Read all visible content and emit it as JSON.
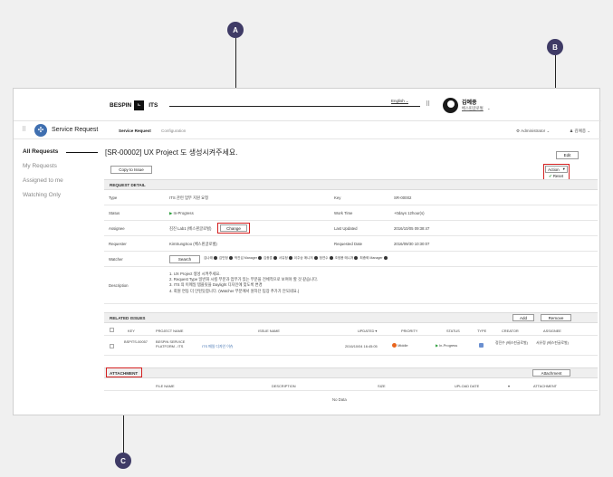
{
  "callouts": {
    "a": "A",
    "b": "B",
    "c": "C"
  },
  "header": {
    "brand": "BESPIN",
    "product": "ITS",
    "language": "English",
    "user_name": "김예종",
    "user_org": "베스핀글로벌"
  },
  "subbar": {
    "app_title": "Service Request",
    "tab_service_request": "Service Request",
    "tab_configuration": "Configuration",
    "admin_label": "Administrator",
    "user_short": "김예종"
  },
  "sidebar": {
    "items": [
      {
        "label": "All Requests"
      },
      {
        "label": "My Requests"
      },
      {
        "label": "Assigned to me"
      },
      {
        "label": "Watching Only"
      }
    ]
  },
  "request": {
    "title": "[SR-00002] UX Project 도 생성시켜주세요.",
    "copy_button": "Copy to Issue",
    "edit_button": "Edit",
    "action_button": "Action",
    "reset_label": "Reset",
    "detail_header": "REQUEST DETAIL",
    "type_label": "Type",
    "type_value": "ITS 관련 업무 지원 요청",
    "key_label": "Key",
    "key_value": "SR-00002",
    "status_label": "Status",
    "status_value": "In-Progress",
    "worktime_label": "Work Time",
    "worktime_value": "+0days 12hour(s)",
    "assignee_label": "Assignee",
    "assignee_value": "김진 Lab1 (베스핀글로벌)",
    "change_button": "Change",
    "lastupdated_label": "Last Updated",
    "lastupdated_value": "2016/10/05 09:38:47",
    "requester_label": "Requester",
    "requester_value": "KimSungSoo (베스핀글로벌)",
    "requested_label": "Requested Date",
    "requested_value": "2016/09/30 10:30:07",
    "watcher_label": "Watcher",
    "search_button": "Search",
    "watchers": [
      "김나래",
      "김민정",
      "박진섭 Manager",
      "김종훈",
      "서유정",
      "이주승 매니저",
      "정연수",
      "조정용 매니저",
      "최종혁 Manager"
    ],
    "description_label": "Description",
    "description_lines": [
      "1. UX Project 생성 시켜주세요.",
      "2. Request Type 일반화 시킬 부분과 업무가 있는 부분을 전체적으로 보여야 할 것 같습니다.",
      "3. ITS 의 이메일 템플릿을 Daylight 디자인에 맞도록 변경",
      "4. 회원 연동 더 안된듯합니다. (Watcher 부분에서 원하던 팀장 추가가 안되네요.)"
    ]
  },
  "related": {
    "header": "RELATED ISSUES",
    "add_button": "Add",
    "remove_button": "Remove",
    "columns": [
      "KEY",
      "PROJECT NAME",
      "ISSUE NAME",
      "UPDATED",
      "PRIORITY",
      "STATUS",
      "TYPE",
      "CREATOR",
      "ASSIGNEE"
    ],
    "rows": [
      {
        "key": "BSPITS-00057",
        "project": "BESPIN SERVICE PLATFORM - ITS",
        "issue": "ITS 메일 디자인 이슈",
        "updated": "2016/10/04 16:45:05",
        "priority": "Middle",
        "status": "In-Progress",
        "creator": "정진수 (베스핀글로벌)",
        "assignee": "서유정 (베스핀글로벌)"
      }
    ]
  },
  "attachment": {
    "header": "ATTACHMENT",
    "button": "Attachment",
    "columns": [
      "FILE NAME",
      "DESCRIPTION",
      "SIZE",
      "UPLOAD DATE",
      "ATTACHMENT"
    ],
    "empty": "No Data"
  },
  "colors": {
    "callout": "#3f3b66",
    "highlight": "#d42020",
    "status_green": "#2a9d3a",
    "priority_orange": "#e8651e",
    "reset_green": "#3aa14a"
  }
}
